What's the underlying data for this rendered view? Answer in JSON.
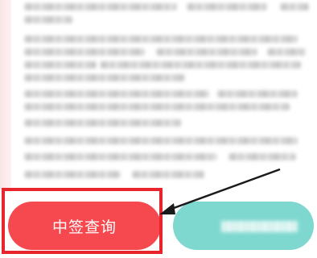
{
  "buttons": {
    "query_label": "中签查询",
    "query_color": "#f5484f",
    "second_color": "#7ed8cf"
  },
  "annotation": {
    "highlight_color": "#e8242c",
    "arrow_color": "#1a1a1a"
  }
}
